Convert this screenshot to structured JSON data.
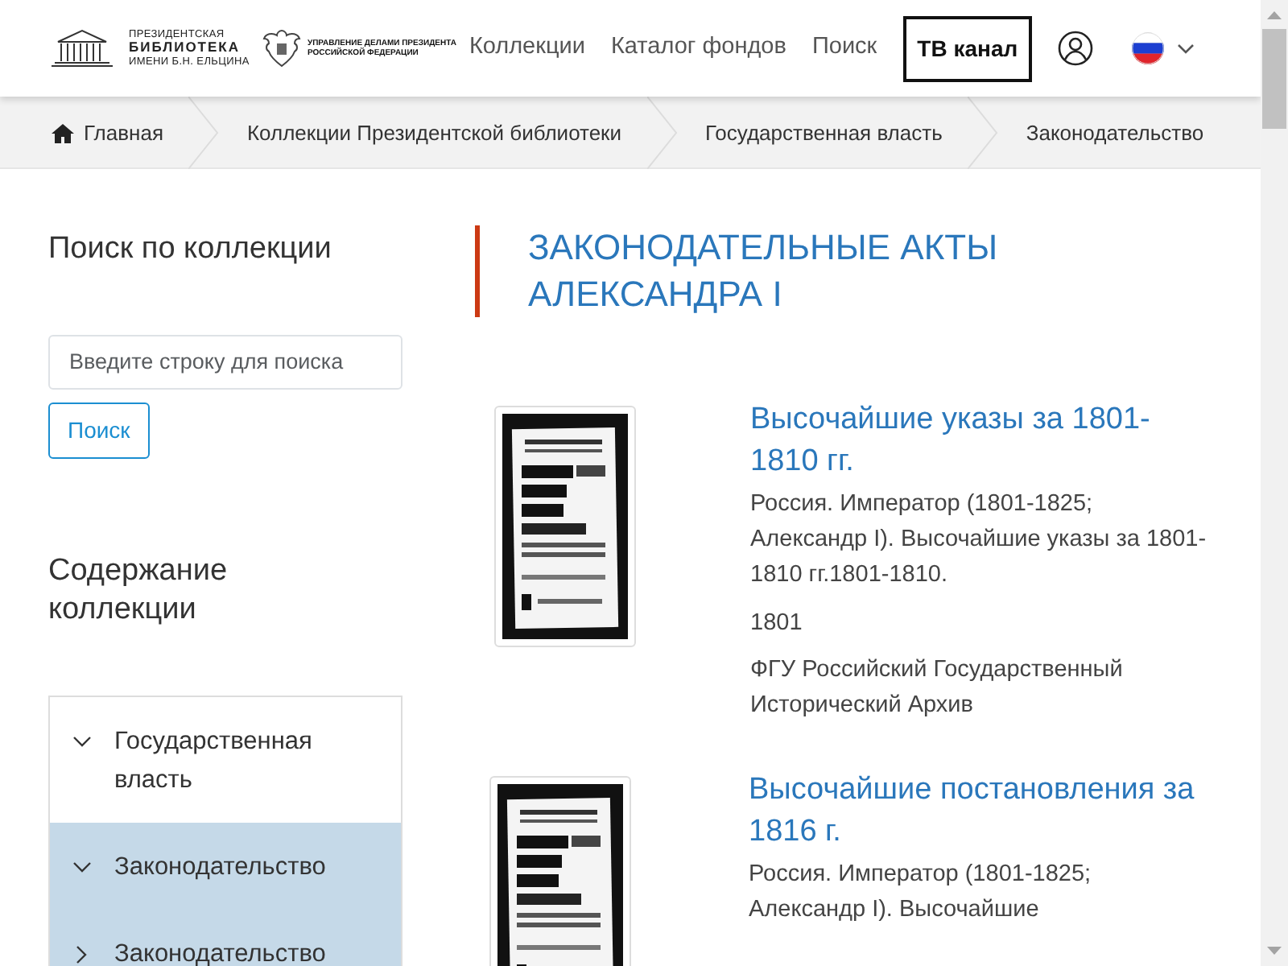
{
  "header": {
    "logo_lines": [
      "ПРЕЗИДЕНТСКАЯ",
      "БИБЛИОТЕКА",
      "ИМЕНИ Б.Н. ЕЛЬЦИНА"
    ],
    "emblem_lines": [
      "УПРАВЛЕНИЕ ДЕЛАМИ ПРЕЗИДЕНТА",
      "РОССИЙСКОЙ ФЕДЕРАЦИИ"
    ],
    "nav": [
      "Коллекции",
      "Каталог фондов",
      "Поиск"
    ],
    "tv_button": "ТВ канал"
  },
  "breadcrumbs": [
    {
      "label": "Главная",
      "kind": "home"
    },
    {
      "label": "Коллекции Президентской библиотеки",
      "kind": "link"
    },
    {
      "label": "Государственная власть",
      "kind": "link"
    },
    {
      "label": "Законодательство",
      "kind": "current"
    }
  ],
  "sidebar": {
    "search_title": "Поиск по коллекции",
    "search": {
      "placeholder": "Введите строку для поиска"
    },
    "search_button": "Поиск",
    "contents_title": "Содержание коллекции",
    "tree": [
      {
        "label": "Государственная власть",
        "expanded": true,
        "selected": false,
        "children": [
          {
            "label": "Законодательство",
            "expanded": true,
            "selected": true,
            "children": [
              {
                "label": "Законодательство",
                "expanded": false,
                "selected": true
              }
            ]
          }
        ]
      }
    ]
  },
  "page_title": "ЗАКОНОДАТЕЛЬНЫЕ АКТЫ АЛЕКСАНДРА I",
  "items": [
    {
      "title": "Высочайшие указы за 1801-1810 гг.",
      "description": "Россия. Император (1801-1825; Александр I). Высочайшие указы за 1801-1810 гг.1801-1810.",
      "year": "1801",
      "source": "ФГУ Российский Государственный Исторический Архив"
    },
    {
      "title": "Высочайшие постановления за 1816 г.",
      "description": "Россия. Император (1801-1825; Александр I). Высочайшие"
    }
  ]
}
